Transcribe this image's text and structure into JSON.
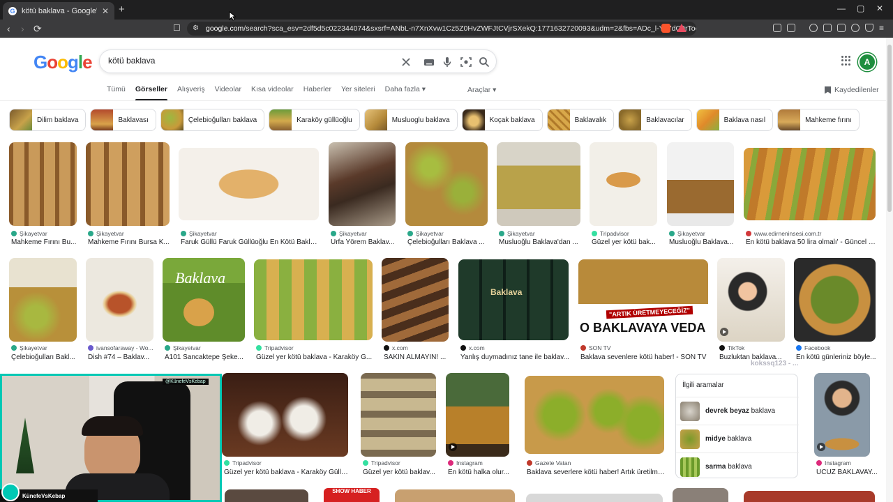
{
  "browser": {
    "tab_title": "kötü baklava - Google'da Ara",
    "new_tab": "+",
    "url_domain": "google.com",
    "url_rest": "/search?sca_esv=2df5d5c022344074&sxsrf=ANbL-n7XnXvw1Cz5Z0HvZWFJtCVjrSXekQ:1771632720093&udm=2&fbs=ADc_l-Yk7dC9rToc...",
    "window_min": "—",
    "window_max": "▢",
    "window_close": "✕"
  },
  "google": {
    "logo_letters": [
      "G",
      "o",
      "o",
      "g",
      "l",
      "e"
    ],
    "query": "kötü baklava",
    "avatar_letter": "A",
    "tabs": [
      "Tümü",
      "Görseller",
      "Alışveriş",
      "Videolar",
      "Kısa videolar",
      "Haberler",
      "Yer siteleri",
      "Daha fazla ▾"
    ],
    "active_tab": "Görseller",
    "tools_label": "Araçlar ▾",
    "saved_label": "Kaydedilenler"
  },
  "chips": [
    "Dilim baklava",
    "Baklavası",
    "Çelebioğulları baklava",
    "Karaköy güllüoğlu",
    "Musluoglu baklava",
    "Koçak baklava",
    "Baklavalık",
    "Baklavacılar",
    "Baklava nasıl",
    "Mahkeme fırını"
  ],
  "results_row1": [
    {
      "source": "Şikayetvar",
      "caption": "Mahkeme Fırını Bu..."
    },
    {
      "source": "Şikayetvar",
      "caption": "Mahkeme Fırını Bursa K..."
    },
    {
      "source": "Şikayetvar",
      "caption": "Faruk Güllü Faruk Güllüoğlu En Kötü Bakla..."
    },
    {
      "source": "Şikayetvar",
      "caption": "Urfa Yörem Baklav..."
    },
    {
      "source": "Şikayetvar",
      "caption": "Çelebioğulları Baklava ..."
    },
    {
      "source": "Şikayetvar",
      "caption": "Musluoğlu Baklava'dan ..."
    },
    {
      "source": "Tripadvisor",
      "caption": "Güzel yer kötü bak..."
    },
    {
      "source": "Şikayetvar",
      "caption": "Musluoğlu Baklava..."
    },
    {
      "source": "www.edirneninsesi.com.tr",
      "caption": "En kötü baklava 50 lira olmalı' - Güncel -..."
    }
  ],
  "results_row2": [
    {
      "source": "Şikayetvar",
      "caption": "Çelebioğulları Bakl..."
    },
    {
      "source": "ivansofaraway - Wo...",
      "caption": "Dish #74 – Baklav..."
    },
    {
      "source": "Şikayetvar",
      "caption": "A101 Sancaktepe Şeke..."
    },
    {
      "source": "Tripadvisor",
      "caption": "Güzel yer kötü baklava - Karaköy G..."
    },
    {
      "source": "x.com",
      "caption": "SAKIN ALMAYIN! ..."
    },
    {
      "source": "x.com",
      "caption": "Yanlış duymadınız tane ile baklav..."
    },
    {
      "source": "SON TV",
      "caption": "Baklava sevenlere kötü haber! - SON TV"
    },
    {
      "source": "TikTok",
      "caption": "Buzluktan baklava..."
    },
    {
      "source": "Facebook",
      "caption": "En kötü günleriniz böyle..."
    }
  ],
  "results_row3": [
    {
      "source": "Tripadvisor",
      "caption": "Güzel yer kötü baklava - Karaköy Güllüo..."
    },
    {
      "source": "Tripadvisor",
      "caption": "Güzel yer kötü baklav..."
    },
    {
      "source": "Instagram",
      "caption": "En kötü halka olur..."
    },
    {
      "source": "Gazete Vatan",
      "caption": "Baklava severlere kötü haber! Artık üretilmey..."
    },
    {
      "source": "Instagram",
      "caption": "UCUZ BAKLAVAY..."
    }
  ],
  "image_text": {
    "veda_banner": "\"ARTIK ÜRETMEYECEĞİZ\"",
    "veda_title": "O BAKLAVAYA VEDA EDİ",
    "baklava_box": "Baklava",
    "show_haber": "SHOW HABER"
  },
  "related": {
    "title": "İlgili aramalar",
    "items": [
      {
        "bold": "devrek beyaz",
        "rest": " baklava"
      },
      {
        "bold": "midye",
        "rest": " baklava"
      },
      {
        "bold": "sarma",
        "rest": " baklava"
      }
    ]
  },
  "stream": {
    "name": "KünefeVsKebap",
    "handle": "@KünefeVsKebap",
    "watermark": "kokssq123 - ..."
  },
  "colors": {
    "google_blue": "#4285f4",
    "google_red": "#ea4335",
    "google_yellow": "#fbbc05",
    "google_green": "#34a853",
    "stream_border": "#00c8b4"
  }
}
